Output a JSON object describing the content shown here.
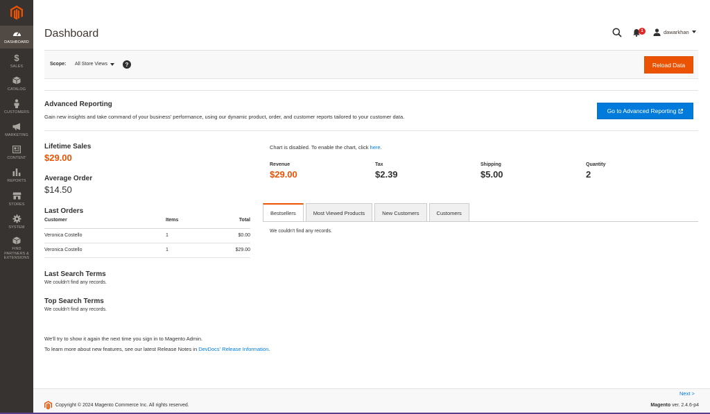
{
  "app": {
    "brand_color": "#eb5202",
    "sidebar_color": "#373330"
  },
  "sidebar": {
    "items": [
      {
        "label": "Dashboard",
        "icon": "dashboard-icon",
        "active": true
      },
      {
        "label": "Sales",
        "icon": "dollar-icon"
      },
      {
        "label": "Catalog",
        "icon": "box-icon"
      },
      {
        "label": "Customers",
        "icon": "person-icon"
      },
      {
        "label": "Marketing",
        "icon": "megaphone-icon"
      },
      {
        "label": "Content",
        "icon": "content-icon"
      },
      {
        "label": "Reports",
        "icon": "bar-chart-icon"
      },
      {
        "label": "Stores",
        "icon": "store-icon"
      },
      {
        "label": "System",
        "icon": "gear-icon"
      },
      {
        "label": "Find Partners & Extensions",
        "icon": "cube-icon"
      }
    ]
  },
  "header": {
    "title": "Dashboard",
    "notification_count": "1",
    "username": "dawarkhan"
  },
  "scope": {
    "label": "Scope:",
    "selected": "All Store Views",
    "help": "?",
    "reload_label": "Reload Data"
  },
  "advanced": {
    "title": "Advanced Reporting",
    "text": "Gain new insights and take command of your business' performance, using our dynamic product, order, and customer reports tailored to your customer data.",
    "button": "Go to Advanced Reporting"
  },
  "stats": {
    "lifetime_label": "Lifetime Sales",
    "lifetime_value": "$29.00",
    "average_label": "Average Order",
    "average_value": "$14.50"
  },
  "last_orders": {
    "title": "Last Orders",
    "columns": [
      "Customer",
      "Items",
      "Total"
    ],
    "rows": [
      {
        "customer": "Veronica Costello",
        "items": "1",
        "total": "$0.00"
      },
      {
        "customer": "Veronica Costello",
        "items": "1",
        "total": "$29.00"
      }
    ]
  },
  "last_search": {
    "title": "Last Search Terms",
    "empty": "We couldn't find any records."
  },
  "top_search": {
    "title": "Top Search Terms",
    "empty": "We couldn't find any records."
  },
  "notes": {
    "line1": "We'll try to show it again the next time you sign in to Magento Admin.",
    "line2_prefix": "To learn more about new features, see our latest Release Notes in ",
    "line2_link": "DevDocs' Release Information",
    "line2_suffix": "."
  },
  "chart": {
    "disabled_text": "Chart is disabled. To enable the chart, click ",
    "link": "here",
    "suffix": "."
  },
  "kpis": [
    {
      "label": "Revenue",
      "value": "$29.00"
    },
    {
      "label": "Tax",
      "value": "$2.39"
    },
    {
      "label": "Shipping",
      "value": "$5.00"
    },
    {
      "label": "Quantity",
      "value": "2"
    }
  ],
  "tabs": {
    "items": [
      "Bestsellers",
      "Most Viewed Products",
      "New Customers",
      "Customers"
    ],
    "active": "Bestsellers",
    "empty": "We couldn't find any records."
  },
  "footer": {
    "next": "Next >",
    "copyright": "Copyright © 2024 Magento Commerce Inc. All rights reserved.",
    "version_brand": "Magento",
    "version_text": " ver. 2.4.6-p4"
  }
}
